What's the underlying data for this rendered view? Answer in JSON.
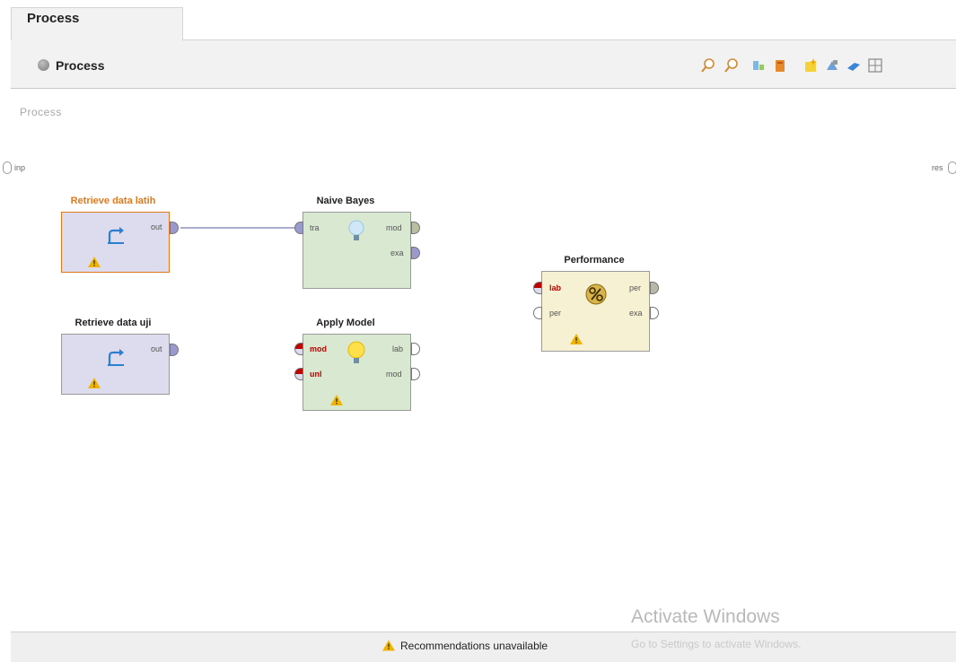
{
  "tabs": [
    {
      "label": "Process"
    }
  ],
  "breadcrumb": {
    "label": "Process"
  },
  "canvas": {
    "label": "Process",
    "left_port": "inp",
    "right_port": "res"
  },
  "operators": {
    "retrieve_latih": {
      "title": "Retrieve data latih",
      "out": "out"
    },
    "retrieve_uji": {
      "title": "Retrieve data uji",
      "out": "out"
    },
    "naive_bayes": {
      "title": "Naive Bayes",
      "in": "tra",
      "out1": "mod",
      "out2": "exa"
    },
    "apply_model": {
      "title": "Apply Model",
      "in1": "mod",
      "in2": "unl",
      "out1": "lab",
      "out2": "mod"
    },
    "performance": {
      "title": "Performance",
      "in1": "lab",
      "in2": "per",
      "out1": "per",
      "out2": "exa"
    }
  },
  "status": {
    "text": "Recommendations unavailable"
  },
  "watermark": {
    "title": "Activate Windows",
    "subtitle": "Go to Settings to activate Windows."
  },
  "toolbar_icons": [
    "zoom-in-icon",
    "zoom-out-icon",
    "auto-wire-icon",
    "delete-icon",
    "new-note-icon",
    "arrange-icon",
    "show-order-icon",
    "fit-grid-icon"
  ],
  "colors": {
    "selected_operator": "#e07a1f",
    "required_port": "#c00000",
    "warning": "#f0b400"
  }
}
